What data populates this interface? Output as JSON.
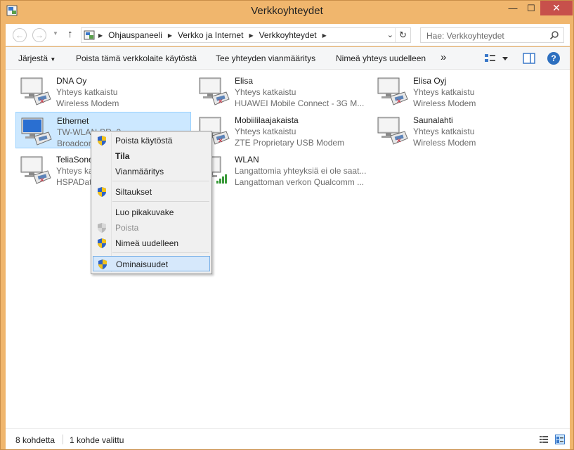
{
  "window": {
    "title": "Verkkoyhteydet",
    "controls": {
      "minimize": "—",
      "maximize": "☐",
      "close": "✕"
    }
  },
  "address": {
    "crumbs": [
      "Ohjauspaneeli",
      "Verkko ja Internet",
      "Verkkoyhteydet"
    ],
    "search_placeholder": "Hae: Verkkoyhteydet"
  },
  "toolbar": {
    "organize": "Järjestä",
    "disable": "Poista tämä verkkolaite käytöstä",
    "diagnose": "Tee yhteyden vianmääritys",
    "rename": "Nimeä yhteys uudelleen",
    "more": "»",
    "help": "?"
  },
  "connections": [
    {
      "name": "DNA Oy",
      "status": "Yhteys katkaistu",
      "device": "Wireless Modem",
      "icon": "modem-disconnected-icon"
    },
    {
      "name": "Elisa",
      "status": "Yhteys katkaistu",
      "device": "HUAWEI Mobile Connect - 3G M...",
      "icon": "modem-disconnected-icon"
    },
    {
      "name": "Elisa Oyj",
      "status": "Yhteys katkaistu",
      "device": "Wireless Modem",
      "icon": "modem-disconnected-icon"
    },
    {
      "name": "Ethernet",
      "status": "TW-WLAN-PR_2",
      "device": "Broadcom",
      "icon": "ethernet-icon",
      "selected": true
    },
    {
      "name": "Mobiililaajakaista",
      "status": "Yhteys katkaistu",
      "device": "ZTE Proprietary USB Modem",
      "icon": "modem-disconnected-icon"
    },
    {
      "name": "Saunalahti",
      "status": "Yhteys katkaistu",
      "device": "Wireless Modem",
      "icon": "modem-disconnected-icon"
    },
    {
      "name": "TeliaSone",
      "status": "Yhteys ka",
      "device": "HSPADat",
      "icon": "modem-disconnected-icon"
    },
    {
      "name": "WLAN",
      "status": "Langattomia yhteyksiä ei ole saat...",
      "device": "Langattoman verkon Qualcomm ...",
      "icon": "wifi-icon"
    }
  ],
  "context_menu": {
    "items": [
      {
        "label": "Poista käytöstä",
        "shield": true
      },
      {
        "label": "Tila",
        "bold": true
      },
      {
        "label": "Vianmääritys"
      },
      {
        "label": "Siltaukset",
        "shield": true
      },
      {
        "label": "Luo pikakuvake"
      },
      {
        "label": "Poista",
        "shield": true,
        "disabled": true
      },
      {
        "label": "Nimeä uudelleen",
        "shield": true
      },
      {
        "label": "Ominaisuudet",
        "shield": true,
        "highlighted": true
      }
    ]
  },
  "statusbar": {
    "count": "8 kohdetta",
    "selected": "1 kohde valittu"
  },
  "colors": {
    "frame": "#f0b66d",
    "close_button": "#c7504b",
    "selection": "#cce8ff",
    "menu_highlight": "#d6e8fb"
  }
}
